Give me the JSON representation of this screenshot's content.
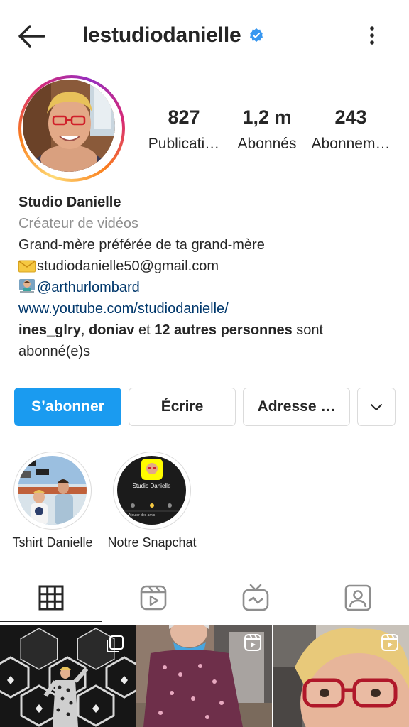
{
  "header": {
    "username": "lestudiodanielle",
    "verified": true,
    "verified_color": "#3897f0"
  },
  "stats": [
    {
      "value": "827",
      "label": "Publicati…"
    },
    {
      "value": "1,2 m",
      "label": "Abonnés"
    },
    {
      "value": "243",
      "label": "Abonnem…"
    }
  ],
  "bio": {
    "name": "Studio Danielle",
    "category": "Créateur de vidéos",
    "description": "Grand-mère préférée de ta grand-mère",
    "email": "studiodanielle50@gmail.com",
    "mention": "@arthurlombard",
    "website": "www.youtube.com/studiodanielle/",
    "followed_user_1": "ines_glry",
    "followed_sep": ", ",
    "followed_user_2": "doniav",
    "followed_and": " et ",
    "followed_others": "12 autres personnes",
    "followed_suffix": " sont abonné(e)s"
  },
  "buttons": {
    "follow": "S’abonner",
    "write": "Écrire",
    "address": "Adresse …"
  },
  "highlights": [
    {
      "label": "Tshirt Danielle"
    },
    {
      "label": "Notre Snapchat",
      "snap_title": "Studio Danielle",
      "snap_add": "Ajouter des amis"
    }
  ],
  "tabs": [
    "grid-icon",
    "reels-icon",
    "igtv-icon",
    "tagged-icon"
  ],
  "colors": {
    "accent": "#1a9bf0",
    "link": "#00376b",
    "muted": "#8e8e8e",
    "border": "#dbdbdb"
  }
}
